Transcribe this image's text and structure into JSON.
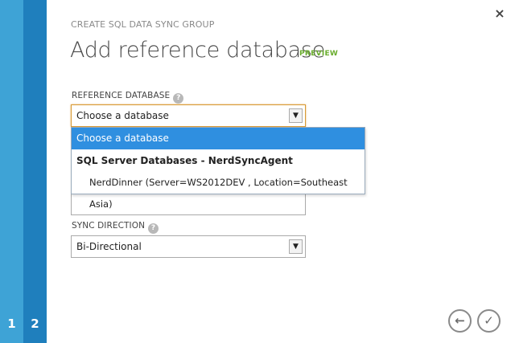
{
  "steps": [
    "1",
    "2"
  ],
  "wizard_title": "CREATE SQL DATA SYNC GROUP",
  "page_title": "Add reference database",
  "preview_badge": "PREVIEW",
  "reference_database": {
    "label": "REFERENCE DATABASE",
    "selected_value": "Choose a database",
    "options": {
      "placeholder": "Choose a database",
      "group_label": "SQL Server Databases - NerdSyncAgent",
      "item": "NerdDinner (Server=WS2012DEV , Location=Southeast Asia)"
    }
  },
  "sync_direction": {
    "label": "SYNC DIRECTION",
    "selected_value": "Bi-Directional"
  },
  "icons": {
    "help": "?",
    "close": "×",
    "dropdown": "▼",
    "back": "←",
    "ok": "✓"
  },
  "colors": {
    "rail_step1": "#3ea3d6",
    "rail_step2": "#1f7fbd",
    "selection": "#2f8fe0",
    "preview": "#6aad2e",
    "focus_border": "#d89a35"
  }
}
